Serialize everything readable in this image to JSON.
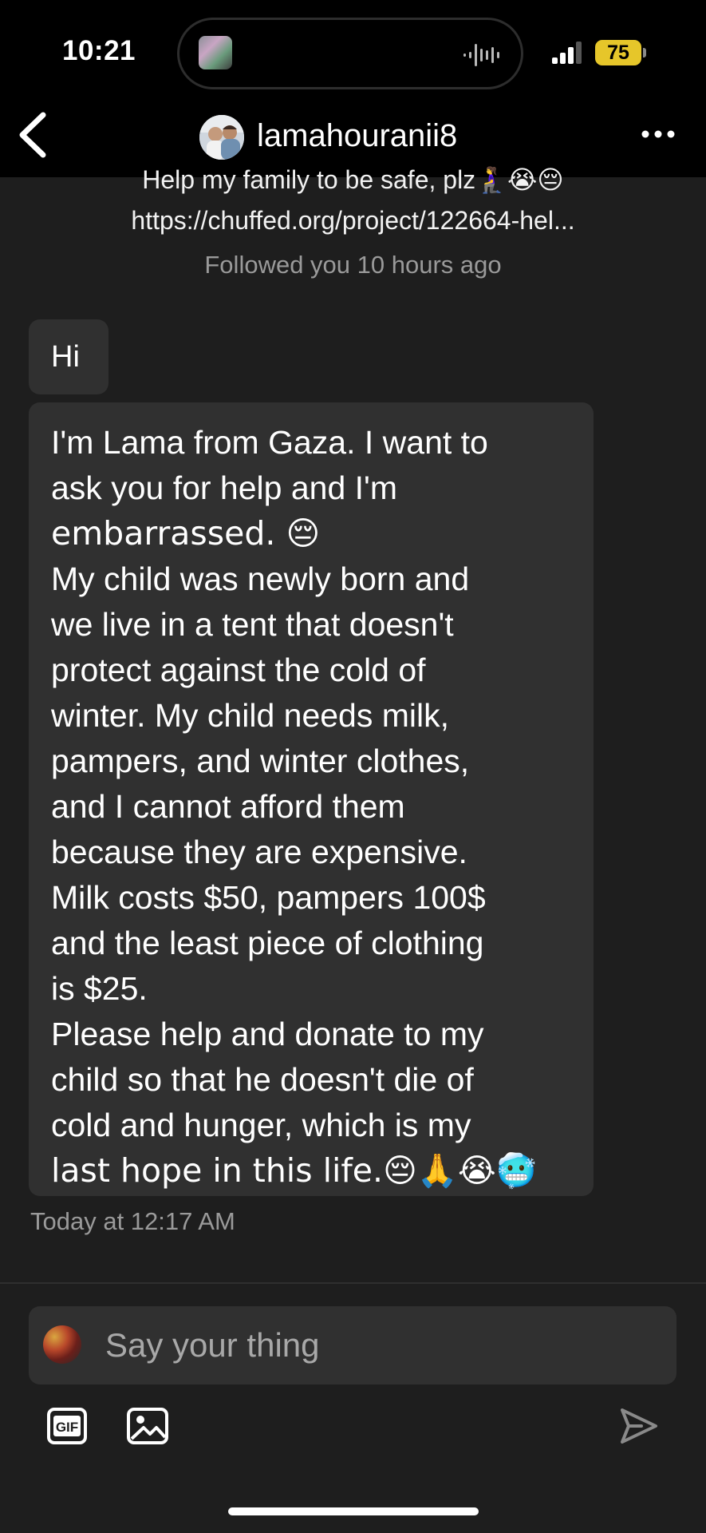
{
  "status_bar": {
    "time": "10:21",
    "battery": "75",
    "accent_battery": "#e6c62a"
  },
  "header": {
    "username": "lamahouranii8",
    "back_icon": "chevron-left-icon",
    "more_icon": "more-horizontal-icon"
  },
  "profile_intro": {
    "bio": "Help my family to be safe, plz🧎‍♀️😭😔",
    "link": "https://chuffed.org/project/122664-hel...",
    "followed": "Followed you 10 hours ago"
  },
  "messages": [
    {
      "text": "Hi"
    },
    {
      "lines": [
        "I'm Lama from Gaza. I want to",
        "ask you for help and I'm",
        "embarrassed. 😔",
        "My child was newly born and",
        "we live in a tent that doesn't",
        "protect against the cold of",
        "winter. My child needs milk,",
        "pampers, and winter clothes,",
        "and I cannot afford them",
        "because they are expensive.",
        "Milk costs $50, pampers 100$",
        "and the least piece of clothing",
        "is $25.",
        "Please help and donate to my",
        "child so that he doesn't die of",
        "cold and hunger, which is my",
        "last hope in this life.😔🙏😭🥶"
      ]
    }
  ],
  "timestamp": "Today at 12:17 AM",
  "composer": {
    "placeholder": "Say your thing",
    "gif_label": "GIF",
    "image_icon": "image-icon",
    "send_icon": "send-icon"
  },
  "colors": {
    "background": "#1e1e1e",
    "bubble": "#303030",
    "muted_text": "#9a9a9a"
  }
}
